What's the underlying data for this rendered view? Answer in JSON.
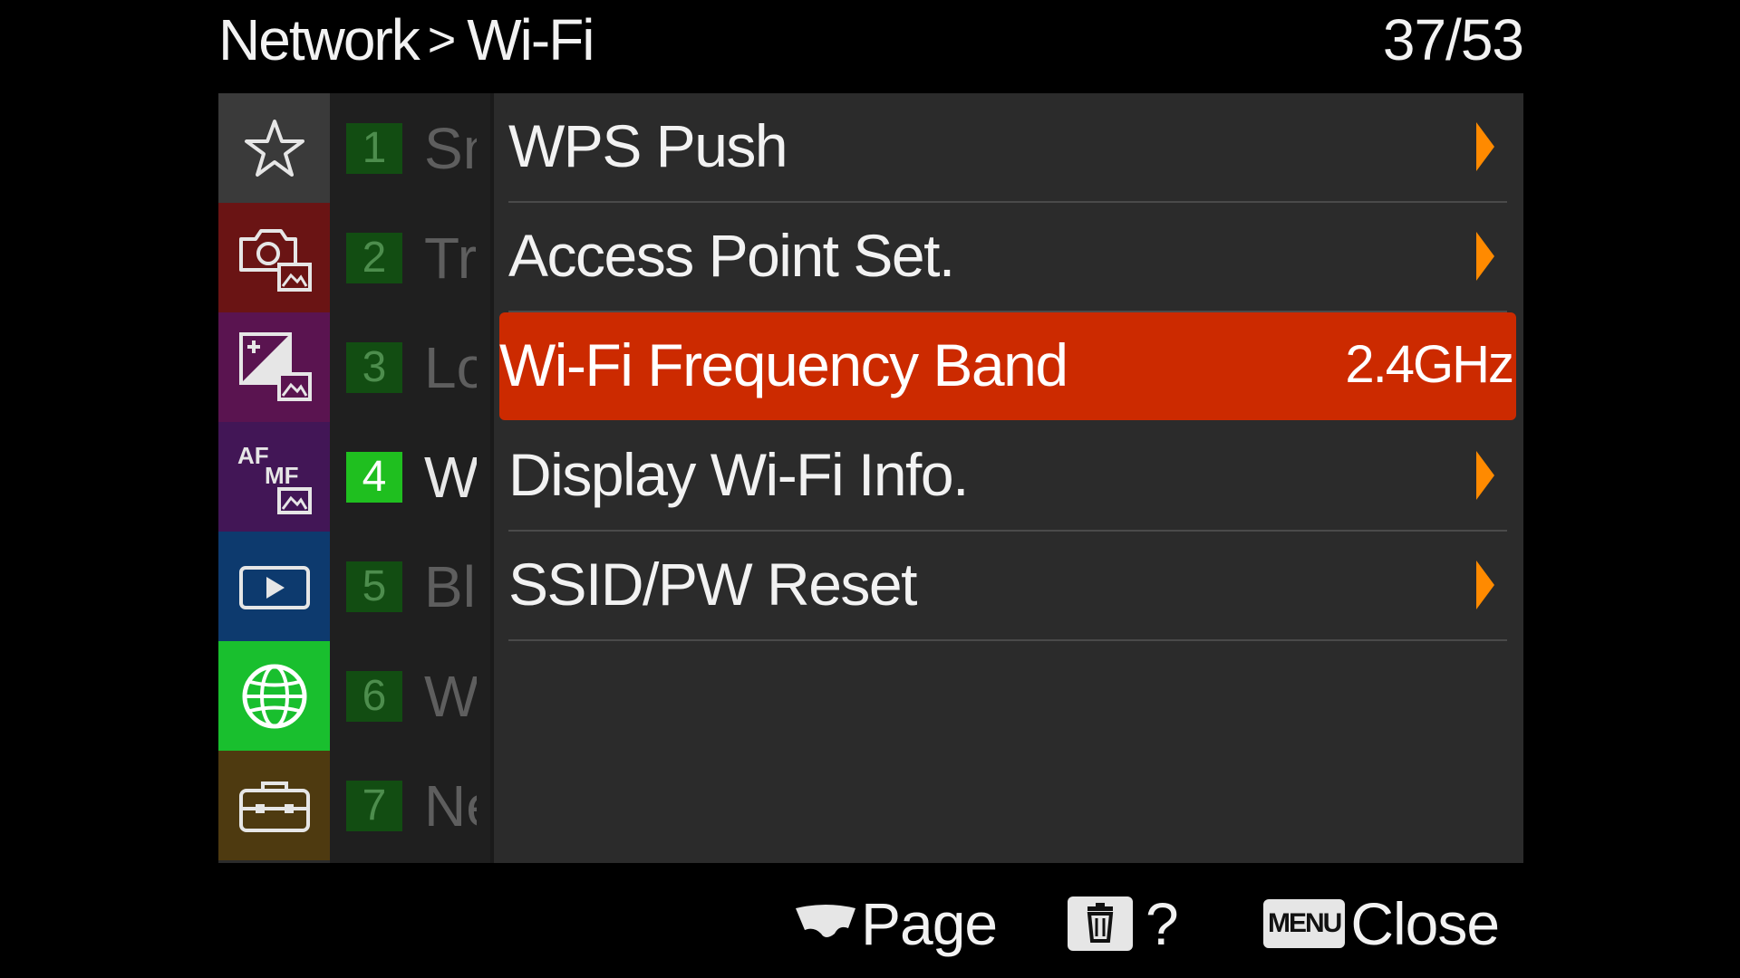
{
  "header": {
    "breadcrumb_parent": "Network",
    "breadcrumb_separator": ">",
    "breadcrumb_current": "Wi-Fi",
    "page_indicator": "37/53"
  },
  "categories": [
    {
      "name": "favorites",
      "icon": "star-icon",
      "color": "#3a3a3a"
    },
    {
      "name": "shooting",
      "icon": "camera-icon",
      "color": "#6a1414"
    },
    {
      "name": "exposure-color",
      "icon": "exposure-icon",
      "color": "#5a1450"
    },
    {
      "name": "focus",
      "icon": "af-mf-icon",
      "color": "#421656",
      "text": "AF MF"
    },
    {
      "name": "playback",
      "icon": "playback-icon",
      "color": "#0d3a6e"
    },
    {
      "name": "network",
      "icon": "globe-icon",
      "color": "#19bf2e"
    },
    {
      "name": "setup",
      "icon": "toolbox-icon",
      "color": "#4e3a10"
    }
  ],
  "pages": [
    {
      "num": "1",
      "abbr": "Sn"
    },
    {
      "num": "2",
      "abbr": "Tr"
    },
    {
      "num": "3",
      "abbr": "Lo"
    },
    {
      "num": "4",
      "abbr": "W"
    },
    {
      "num": "5",
      "abbr": "Bl"
    },
    {
      "num": "6",
      "abbr": "W"
    },
    {
      "num": "7",
      "abbr": "Ne"
    }
  ],
  "active_page": "4",
  "menu": {
    "items": [
      {
        "label": "WPS Push"
      },
      {
        "label": "Access Point Set."
      },
      {
        "label": "Wi-Fi Frequency Band",
        "value": "2.4GHz"
      },
      {
        "label": "Display Wi-Fi Info."
      },
      {
        "label": "SSID/PW Reset"
      }
    ],
    "selected_index": 2
  },
  "footer": {
    "page_label": "Page",
    "help_label": "?",
    "menu_key": "MENU",
    "close_label": "Close"
  },
  "colors": {
    "highlight": "#cc2a00",
    "arrow": "#ff8a00",
    "active_page": "#1fbf1f"
  }
}
